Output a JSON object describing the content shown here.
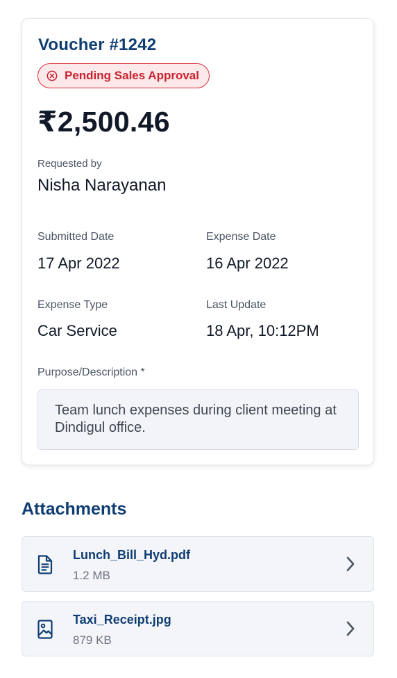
{
  "voucher": {
    "title": "Voucher #1242",
    "status": "Pending Sales Approval",
    "status_icon": "x-circle-icon",
    "amount": "₹2,500.46",
    "requested_by_label": "Requested by",
    "requested_by": "Nisha Narayanan",
    "submitted_date_label": "Submitted Date",
    "submitted_date": "17 Apr 2022",
    "expense_date_label": "Expense Date",
    "expense_date": "16 Apr 2022",
    "expense_type_label": "Expense Type",
    "expense_type": "Car Service",
    "last_update_label": "Last Update",
    "last_update": "18 Apr, 10:12PM",
    "description_label": "Purpose/Description *",
    "description": "Team lunch expenses during client meeting at Dindigul office."
  },
  "attachments": {
    "title": "Attachments",
    "items": [
      {
        "name": "Lunch_Bill_Hyd.pdf",
        "size": "1.2 MB",
        "icon": "document-icon"
      },
      {
        "name": "Taxi_Receipt.jpg",
        "size": "879 KB",
        "icon": "image-file-icon"
      }
    ]
  },
  "colors": {
    "brand": "#0f3d73",
    "status_red": "#c8222f",
    "status_bg": "#fde8ea"
  }
}
